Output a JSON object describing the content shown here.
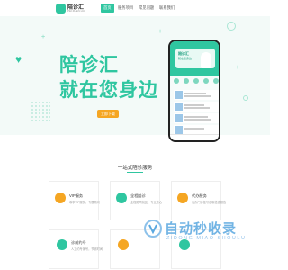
{
  "header": {
    "logo_text": "陪诊汇",
    "logo_sub": "PEI ZHEN HUI",
    "nav": [
      {
        "label": "首页"
      },
      {
        "label": "服务项目"
      },
      {
        "label": "常见问题"
      },
      {
        "label": "联系我们"
      }
    ]
  },
  "hero": {
    "title": "陪诊汇",
    "subtitle": "就在您身边",
    "button_label": "立即下载"
  },
  "phone": {
    "card_title": "陪诊汇",
    "card_subtitle": "就在您身边"
  },
  "services": {
    "section_title": "一站式陪诊服务",
    "items": [
      {
        "title": "VIP服务",
        "desc": "尊享VIP服务，专属顾问",
        "color": "#f5a623"
      },
      {
        "title": "全程陪诊",
        "desc": "全程陪同就医、专业放心",
        "color": "#2fc6a0"
      },
      {
        "title": "代办服务",
        "desc": "代办门诊挂号及取检查报告",
        "color": "#f5a623"
      },
      {
        "title": "诊前约号",
        "desc": "人工约专家号，节省时间",
        "color": "#2fc6a0"
      },
      {
        "title": "",
        "desc": "",
        "color": "#f5a623"
      },
      {
        "title": "",
        "desc": "",
        "color": "#2fc6a0"
      }
    ]
  },
  "watermark": {
    "text": "自动秒收录",
    "sub": "ZIDONG MIAO SHOULU"
  },
  "colors": {
    "brand": "#2fc6a0",
    "accent": "#f5a623"
  }
}
